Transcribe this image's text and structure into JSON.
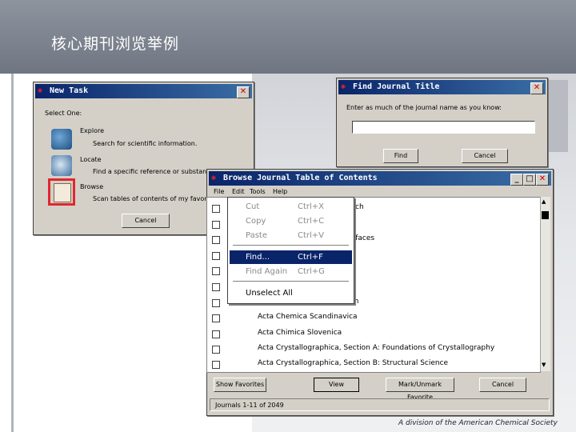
{
  "slide": {
    "title": "核心期刊浏览举例",
    "footer": "A division of the American Chemical Society"
  },
  "new_task": {
    "title": "New Task",
    "close": "✕",
    "select_label": "Select One:",
    "options": [
      {
        "name": "Explore",
        "desc": "Search for scientific information."
      },
      {
        "name": "Locate",
        "desc": "Find a specific reference or substance"
      },
      {
        "name": "Browse",
        "desc": "Scan tables of contents of my favorite"
      }
    ],
    "cancel": "Cancel"
  },
  "find_journal": {
    "title": "Find Journal Title",
    "prompt": "Enter as much of the journal name as you know:",
    "value": "",
    "find": "Find",
    "cancel": "Cancel"
  },
  "browse_toc": {
    "title": "Browse Journal Table of Contents",
    "menu": [
      "File",
      "Edit",
      "Tools",
      "Help"
    ],
    "rows": [
      "",
      "",
      "",
      "",
      "",
      "",
      "",
      "Acta Chemica Scandinavica",
      "Acta Chimica Slovenica",
      "Acta Crystallographica, Section A: Foundations of Crystallography",
      "Acta Crystallographica, Section B: Structural Science"
    ],
    "partial": [
      "arch",
      "erfaces",
      "Acta Electrochim Photochim"
    ],
    "buttons": {
      "show": "Show Favorites",
      "view": "View",
      "mark": "Mark/Unmark Favorite",
      "cancel": "Cancel"
    },
    "status": "Journals 1-11 of 2049"
  },
  "edit_menu": [
    {
      "label": "Cut",
      "shortcut": "Ctrl+X",
      "disabled": true
    },
    {
      "label": "Copy",
      "shortcut": "Ctrl+C",
      "disabled": true
    },
    {
      "label": "Paste",
      "shortcut": "Ctrl+V",
      "disabled": true
    },
    {
      "label": "Find...",
      "shortcut": "Ctrl+F",
      "selected": true
    },
    {
      "label": "Find Again",
      "shortcut": "Ctrl+G",
      "disabled": true
    },
    {
      "label": "Unselect All",
      "shortcut": ""
    }
  ],
  "colors": {
    "titlebar": "#0a246a",
    "selection": "#0a246a",
    "highlight_box": "#e0282d"
  }
}
